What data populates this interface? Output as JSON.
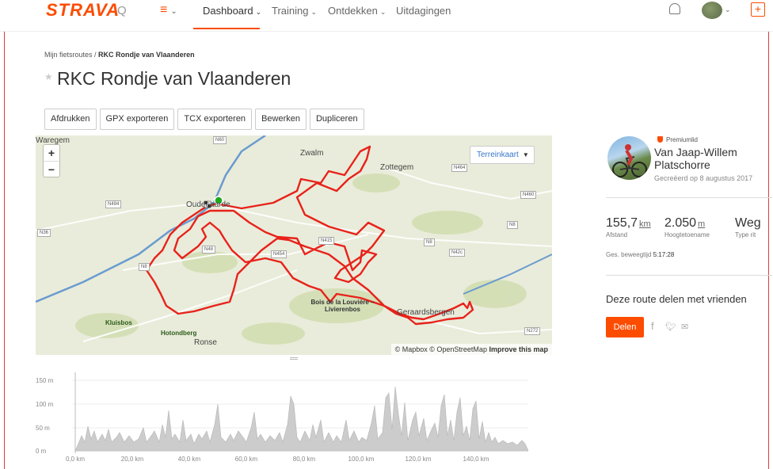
{
  "nav": {
    "logo": "STRAVA",
    "search_glyph": "Q",
    "menu_glyph": "≡",
    "items": [
      {
        "label": "Dashboard",
        "active": true
      },
      {
        "label": "Training",
        "active": false
      },
      {
        "label": "Ontdekken",
        "active": false
      },
      {
        "label": "Uitdagingen",
        "active": false
      }
    ],
    "plus_glyph": "+"
  },
  "breadcrumb": {
    "parent": "Mijn fietsroutes",
    "separator": " / ",
    "current": "RKC Rondje van Vlaanderen"
  },
  "title": "RKC Rondje van Vlaanderen",
  "actions": [
    "Afdrukken",
    "GPX exporteren",
    "TCX exporteren",
    "Bewerken",
    "Dupliceren"
  ],
  "map": {
    "zoom_in": "+",
    "zoom_out": "−",
    "layer_select": "Terreinkaart",
    "attribution": "© Mapbox © OpenStreetMap",
    "improve_link": "Improve this map",
    "places": [
      "Zwalm",
      "Zottegem",
      "Oudenaarde",
      "Ronse",
      "Geraardsbergen",
      "Hotondberg",
      "Kluisbos",
      "Bois de la Louvière – Livierenbos",
      "Waregem"
    ],
    "roads": [
      "N60",
      "N464",
      "N460",
      "N494",
      "N8",
      "N36",
      "N415",
      "N454",
      "N8",
      "N42c",
      "N8",
      "N272",
      "N48"
    ],
    "route_color": "#e8221b"
  },
  "elevation": {
    "y_ticks": [
      "150 m",
      "100 m",
      "50 m",
      "0 m"
    ],
    "x_ticks": [
      "0,0 km",
      "20,0 km",
      "40,0 km",
      "60,0 km",
      "80,0 km",
      "100,0 km",
      "120,0 km",
      "140,0 km"
    ]
  },
  "athlete": {
    "badge": "Premiumlid",
    "name": "Van Jaap-Willem Platschorre",
    "created": "Gecreëerd op 8 augustus 2017"
  },
  "stats": [
    {
      "value": "155,7",
      "unit": "km",
      "label": "Afstand"
    },
    {
      "value": "2.050",
      "unit": "m",
      "label": "Hoogtetoename"
    },
    {
      "value": "Weg",
      "unit": "",
      "label": "Type rit"
    }
  ],
  "moving_time": {
    "label": "Ges. beweegtijd",
    "value": "5:17:28"
  },
  "share": {
    "title": "Deze route delen met vrienden",
    "button": "Delen",
    "icons": [
      "facebook-icon",
      "twitter-icon",
      "email-icon"
    ]
  },
  "colors": {
    "brand": "#fc4c02",
    "route": "#e8221b",
    "map_bg": "#e9ecda",
    "river": "#6a9bd0"
  }
}
